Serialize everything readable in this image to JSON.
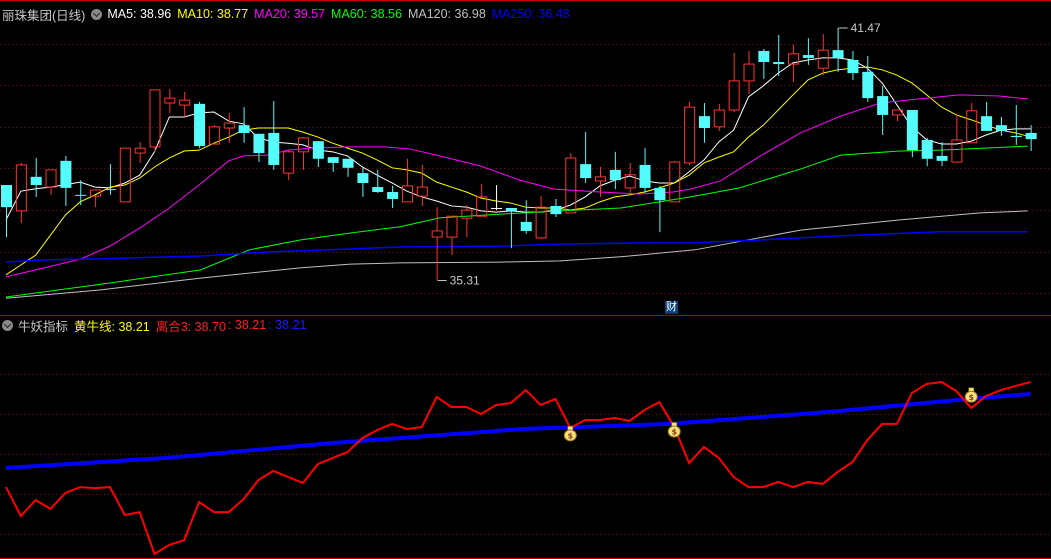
{
  "main_header": {
    "title": "丽珠集团(日线)",
    "ma": [
      {
        "label": "MA5: 38.96",
        "color": "#ffffff"
      },
      {
        "label": "MA10: 38.77",
        "color": "#ffff00"
      },
      {
        "label": "MA20: 39.57",
        "color": "#ff00ff"
      },
      {
        "label": "MA60: 38.56",
        "color": "#00ff00"
      },
      {
        "label": "MA120: 36.98",
        "color": "#c0c0c0"
      },
      {
        "label": "MA250: 36.48",
        "color": "#0000ff"
      }
    ]
  },
  "indicator_header": {
    "title": "牛妖指标",
    "yellow_label": "黄牛线: 38.21",
    "red_label": "离合3: 38.70",
    "sep_value": ": 38.21",
    "blue_value": ": 38.21"
  },
  "finance_badge": "财",
  "colors": {
    "up": "#ff3232",
    "down": "#54fcfc",
    "grid": "#8b0000",
    "border": "#c00000"
  },
  "chart_data": [
    {
      "type": "candlestick",
      "title": "丽珠集团(日线)",
      "high_label": {
        "index": 56,
        "text": "41.47"
      },
      "low_label": {
        "index": 29,
        "text": "35.31"
      },
      "candles_ohlc": [
        [
          37.64,
          37.64,
          36.37,
          37.1
        ],
        [
          37.01,
          38.18,
          36.71,
          38.13
        ],
        [
          37.84,
          38.3,
          37.35,
          37.64
        ],
        [
          37.59,
          38.01,
          37.4,
          38.01
        ],
        [
          38.23,
          38.35,
          37.13,
          37.57
        ],
        [
          37.4,
          37.76,
          37.15,
          37.39
        ],
        [
          37.37,
          37.52,
          37.1,
          37.52
        ],
        [
          37.54,
          38.15,
          37.4,
          37.53
        ],
        [
          37.23,
          38.54,
          37.23,
          38.54
        ],
        [
          38.42,
          38.69,
          38.18,
          38.54
        ],
        [
          38.57,
          39.96,
          38.45,
          39.96
        ],
        [
          39.64,
          39.98,
          39.4,
          39.76
        ],
        [
          39.59,
          39.91,
          39.3,
          39.71
        ],
        [
          39.62,
          39.67,
          38.54,
          38.59
        ],
        [
          38.64,
          39.1,
          38.64,
          39.06
        ],
        [
          39.03,
          39.4,
          38.67,
          39.15
        ],
        [
          39.1,
          39.54,
          38.67,
          38.91
        ],
        [
          38.89,
          38.89,
          38.2,
          38.42
        ],
        [
          38.91,
          39.69,
          38.01,
          38.13
        ],
        [
          37.93,
          38.5,
          37.76,
          38.45
        ],
        [
          38.45,
          38.81,
          38.01,
          38.79
        ],
        [
          38.71,
          38.71,
          38.08,
          38.28
        ],
        [
          38.32,
          38.32,
          37.96,
          38.18
        ],
        [
          38.28,
          38.28,
          37.84,
          38.06
        ],
        [
          37.93,
          38.08,
          37.35,
          37.69
        ],
        [
          37.59,
          38.01,
          37.45,
          37.47
        ],
        [
          37.47,
          37.62,
          37.08,
          37.3
        ],
        [
          37.23,
          38.28,
          37.23,
          37.62
        ],
        [
          37.37,
          38.13,
          37.13,
          37.59
        ],
        [
          36.37,
          37.1,
          35.31,
          36.52
        ],
        [
          36.37,
          36.88,
          35.93,
          36.88
        ],
        [
          36.83,
          37.15,
          36.37,
          37.03
        ],
        [
          36.88,
          37.67,
          36.88,
          37.35
        ],
        [
          37.08,
          37.64,
          37.03,
          37.08
        ],
        [
          37.08,
          37.08,
          36.1,
          37.01
        ],
        [
          36.74,
          37.27,
          36.45,
          36.52
        ],
        [
          36.35,
          37.37,
          36.32,
          37.1
        ],
        [
          37.13,
          37.3,
          36.86,
          36.93
        ],
        [
          36.96,
          38.42,
          36.96,
          38.3
        ],
        [
          38.15,
          38.93,
          37.69,
          37.81
        ],
        [
          37.74,
          38.08,
          37.35,
          37.84
        ],
        [
          38.01,
          38.45,
          37.54,
          37.76
        ],
        [
          37.57,
          38.18,
          37.45,
          37.89
        ],
        [
          38.13,
          38.54,
          37.45,
          37.57
        ],
        [
          37.57,
          37.62,
          36.49,
          37.27
        ],
        [
          37.23,
          38.23,
          37.23,
          38.2
        ],
        [
          38.18,
          39.67,
          38.13,
          39.54
        ],
        [
          39.32,
          39.64,
          38.67,
          39.03
        ],
        [
          39.06,
          39.62,
          38.96,
          39.47
        ],
        [
          39.47,
          40.86,
          39.42,
          40.18
        ],
        [
          40.18,
          40.91,
          39.86,
          40.59
        ],
        [
          40.91,
          40.96,
          40.23,
          40.64
        ],
        [
          40.64,
          41.3,
          40.3,
          40.59
        ],
        [
          40.59,
          41.06,
          40.15,
          40.84
        ],
        [
          40.81,
          41.22,
          40.57,
          40.74
        ],
        [
          40.49,
          41.32,
          40.32,
          40.93
        ],
        [
          40.93,
          41.47,
          40.4,
          40.74
        ],
        [
          40.69,
          40.91,
          40.2,
          40.37
        ],
        [
          40.4,
          40.79,
          39.67,
          39.76
        ],
        [
          39.81,
          40.06,
          38.86,
          39.35
        ],
        [
          39.35,
          39.47,
          39.2,
          39.47
        ],
        [
          39.47,
          39.47,
          38.32,
          38.49
        ],
        [
          38.74,
          38.79,
          38.1,
          38.28
        ],
        [
          38.35,
          38.69,
          38.1,
          38.23
        ],
        [
          38.2,
          39.37,
          38.2,
          38.74
        ],
        [
          38.67,
          39.64,
          38.67,
          39.45
        ],
        [
          39.32,
          39.67,
          38.96,
          38.96
        ],
        [
          39.1,
          39.3,
          38.84,
          38.96
        ],
        [
          38.84,
          39.59,
          38.62,
          38.81
        ],
        [
          38.91,
          39.1,
          38.47,
          38.76
        ]
      ],
      "ma_lines": [
        {
          "name": "MA5",
          "color": "#ffffff",
          "values": [
            36.79,
            37.49,
            37.55,
            37.59,
            37.65,
            37.71,
            37.59,
            37.57,
            37.69,
            37.88,
            38.45,
            39.3,
            39.3,
            39.4,
            39.42,
            39.2,
            39.13,
            38.79,
            38.69,
            38.66,
            38.62,
            38.49,
            38.45,
            38.35,
            38.08,
            37.88,
            37.69,
            37.49,
            37.35,
            37.25,
            37.13,
            37.1,
            37.01,
            36.98,
            37.01,
            36.98,
            36.98,
            37.03,
            37.15,
            37.35,
            37.62,
            37.76,
            37.86,
            37.74,
            37.69,
            37.69,
            37.96,
            38.25,
            38.69,
            38.98,
            39.79,
            40.06,
            40.37,
            40.62,
            40.69,
            40.74,
            40.74,
            40.69,
            40.49,
            40.13,
            39.59,
            39.06,
            38.74,
            38.64,
            38.64,
            38.71,
            38.86,
            38.98,
            39.01,
            39.01
          ]
        },
        {
          "name": "MA10",
          "color": "#ffff00",
          "values": [
            35.45,
            35.69,
            35.93,
            36.42,
            36.91,
            37.23,
            37.4,
            37.59,
            37.64,
            37.81,
            38.08,
            38.3,
            38.47,
            38.49,
            38.66,
            38.81,
            38.98,
            39.03,
            39.03,
            39.03,
            38.93,
            38.81,
            38.66,
            38.54,
            38.42,
            38.25,
            38.06,
            38.01,
            37.93,
            37.71,
            37.59,
            37.47,
            37.32,
            37.25,
            37.2,
            37.1,
            37.08,
            37.08,
            37.03,
            37.08,
            37.23,
            37.35,
            37.4,
            37.47,
            37.57,
            37.69,
            37.88,
            38.18,
            38.32,
            38.45,
            38.81,
            39.1,
            39.47,
            39.84,
            40.2,
            40.37,
            40.45,
            40.49,
            40.52,
            40.45,
            40.32,
            40.13,
            39.84,
            39.54,
            39.35,
            39.23,
            39.1,
            38.98,
            38.91,
            38.81
          ]
        },
        {
          "name": "MA20",
          "color": "#ff00ff",
          "points": [
            [
              0,
              35.4
            ],
            [
              5,
              35.83
            ],
            [
              7,
              36.15
            ],
            [
              9,
              36.59
            ],
            [
              11,
              37.08
            ],
            [
              13,
              37.64
            ],
            [
              15,
              38.23
            ],
            [
              16,
              38.35
            ],
            [
              17.6,
              38.37
            ],
            [
              19,
              38.49
            ],
            [
              20.5,
              38.54
            ],
            [
              23.2,
              38.57
            ],
            [
              25.5,
              38.57
            ],
            [
              27.2,
              38.52
            ],
            [
              29.2,
              38.35
            ],
            [
              31.9,
              38.11
            ],
            [
              34.6,
              37.76
            ],
            [
              36.9,
              37.54
            ],
            [
              40,
              37.47
            ],
            [
              42.7,
              37.42
            ],
            [
              44.9,
              37.47
            ],
            [
              46.1,
              37.54
            ],
            [
              48.1,
              37.74
            ],
            [
              50.8,
              38.35
            ],
            [
              53.5,
              38.91
            ],
            [
              56.2,
              39.32
            ],
            [
              58.9,
              39.64
            ],
            [
              61.5,
              39.74
            ],
            [
              64.2,
              39.84
            ],
            [
              66.9,
              39.81
            ],
            [
              68.8,
              39.74
            ]
          ]
        },
        {
          "name": "MA60",
          "color": "#00ff00",
          "points": [
            [
              0,
              34.91
            ],
            [
              7,
              35.25
            ],
            [
              13.1,
              35.57
            ],
            [
              16.4,
              36.06
            ],
            [
              19.8,
              36.3
            ],
            [
              23.2,
              36.47
            ],
            [
              26.5,
              36.62
            ],
            [
              29.2,
              36.84
            ],
            [
              33.3,
              36.93
            ],
            [
              37.3,
              37.01
            ],
            [
              41.4,
              37.08
            ],
            [
              46.1,
              37.35
            ],
            [
              49.4,
              37.57
            ],
            [
              53.5,
              38.03
            ],
            [
              56.2,
              38.37
            ],
            [
              60.2,
              38.47
            ],
            [
              62.9,
              38.49
            ],
            [
              68.8,
              38.59
            ]
          ]
        },
        {
          "name": "MA120",
          "color": "#c0c0c0",
          "points": [
            [
              0,
              34.88
            ],
            [
              6.3,
              35.08
            ],
            [
              13.1,
              35.37
            ],
            [
              19.8,
              35.62
            ],
            [
              23.2,
              35.71
            ],
            [
              26.5,
              35.74
            ],
            [
              33.3,
              35.76
            ],
            [
              37.3,
              35.79
            ],
            [
              41.4,
              35.89
            ],
            [
              46.4,
              36.06
            ],
            [
              53.5,
              36.54
            ],
            [
              60.2,
              36.79
            ],
            [
              65.6,
              36.96
            ],
            [
              68.8,
              37.01
            ]
          ]
        },
        {
          "name": "MA250",
          "color": "#0000ff",
          "points": [
            [
              0,
              35.76
            ],
            [
              2.3,
              35.81
            ],
            [
              6.3,
              35.84
            ],
            [
              13.1,
              35.91
            ],
            [
              17.8,
              36.01
            ],
            [
              23.2,
              36.08
            ],
            [
              26.5,
              36.13
            ],
            [
              33.3,
              36.15
            ],
            [
              37.3,
              36.2
            ],
            [
              43.4,
              36.23
            ],
            [
              46.1,
              36.23
            ],
            [
              50.8,
              36.3
            ],
            [
              56.2,
              36.4
            ],
            [
              62.9,
              36.5
            ],
            [
              68.8,
              36.5
            ]
          ]
        }
      ]
    },
    {
      "type": "line",
      "title": "牛妖指标",
      "series": [
        {
          "name": "离合3",
          "color": "#ff0000",
          "values": [
            34.41,
            33.23,
            33.88,
            33.52,
            34.17,
            34.41,
            34.37,
            34.41,
            33.27,
            33.39,
            31.68,
            32.05,
            32.25,
            33.8,
            33.39,
            33.39,
            33.92,
            34.7,
            35.07,
            34.82,
            34.58,
            35.35,
            35.6,
            35.84,
            36.41,
            36.74,
            36.99,
            36.78,
            36.86,
            38.09,
            37.68,
            37.68,
            37.39,
            37.76,
            37.84,
            38.37,
            37.76,
            38.01,
            36.82,
            37.15,
            37.15,
            37.23,
            37.11,
            37.56,
            37.88,
            36.86,
            35.39,
            36.05,
            35.6,
            34.82,
            34.41,
            34.41,
            34.62,
            34.41,
            34.62,
            34.54,
            35.03,
            35.43,
            36.33,
            36.99,
            36.99,
            38.25,
            38.62,
            38.7,
            38.33,
            37.64,
            38.13,
            38.37,
            38.54,
            38.7
          ]
        },
        {
          "name": "黄牛线",
          "color": "#0000ff",
          "points": [
            [
              0,
              35.19
            ],
            [
              10.8,
              35.6
            ],
            [
              22,
              36.21
            ],
            [
              34.8,
              36.78
            ],
            [
              44.7,
              36.99
            ],
            [
              55.5,
              37.48
            ],
            [
              64.9,
              38.01
            ],
            [
              69,
              38.21
            ]
          ]
        }
      ],
      "signals": [
        {
          "index": 38,
          "icon": "money-bag-icon"
        },
        {
          "index": 45,
          "icon": "money-bag-icon"
        },
        {
          "index": 65,
          "icon": "money-bag-icon"
        }
      ]
    }
  ]
}
